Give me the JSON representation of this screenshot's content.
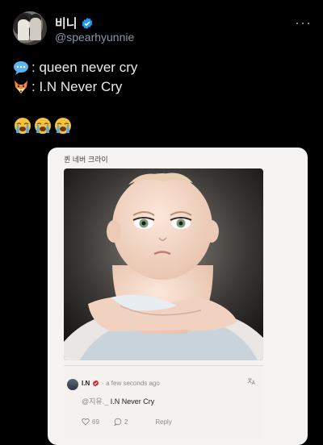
{
  "tweet": {
    "display_name": "비니",
    "handle": "@spearhyunnie",
    "more_label": "···",
    "lines": [
      {
        "icon": "speech-bubble-icon",
        "text": ": queen never cry"
      },
      {
        "icon": "fox-face-icon",
        "text": ": I.N Never Cry"
      }
    ],
    "reaction_icons": [
      "loudly-crying-face-icon",
      "loudly-crying-face-icon",
      "loudly-crying-face-icon"
    ]
  },
  "media": {
    "title": "퀸 네버 크라이",
    "comment": {
      "user": "I.N",
      "time": "· a few seconds ago",
      "translate_icon": "translate-icon",
      "mention": "@지유._",
      "text": "I.N Never Cry",
      "likes": "69",
      "replies": "2",
      "reply_label": "Reply"
    }
  },
  "colors": {
    "verified": "#1d9bf0",
    "handle": "#8b98a5",
    "background": "#000000"
  }
}
